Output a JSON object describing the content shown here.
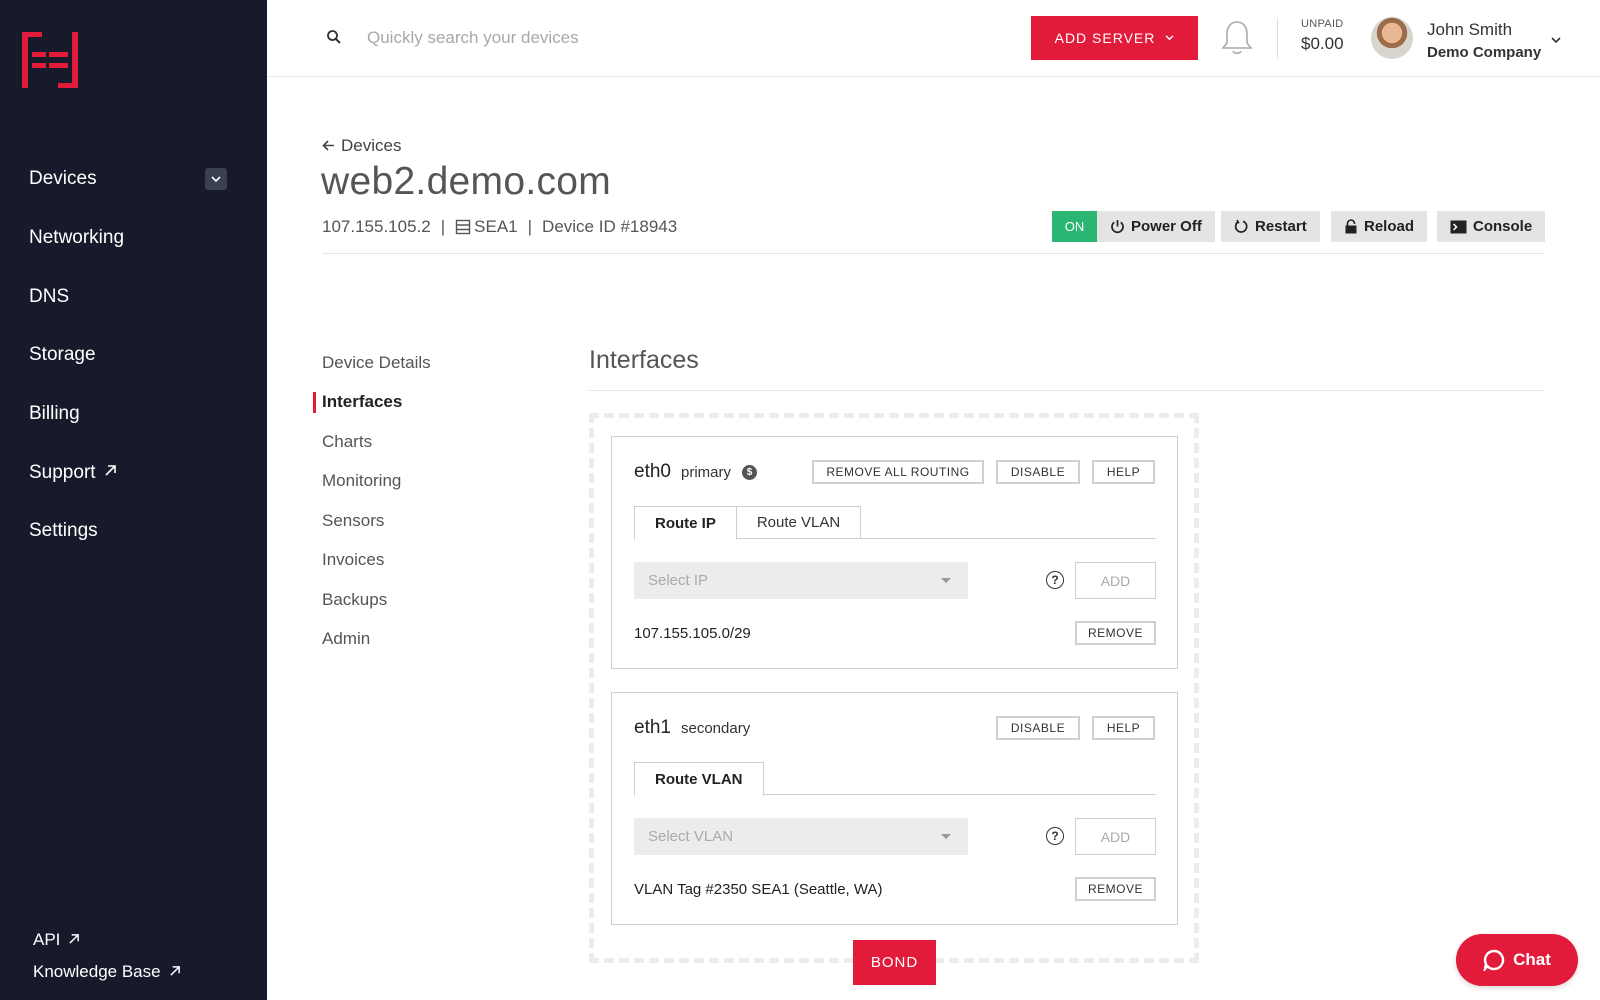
{
  "sidebar": {
    "logo": "hivelocity-logo",
    "items": [
      {
        "label": "Devices",
        "icon": "chevron-down-icon"
      },
      {
        "label": "Networking"
      },
      {
        "label": "DNS"
      },
      {
        "label": "Storage"
      },
      {
        "label": "Billing"
      },
      {
        "label": "Support",
        "icon": "external-link-icon"
      },
      {
        "label": "Settings"
      }
    ],
    "bottom_links": [
      {
        "label": "API",
        "icon": "external-link-icon"
      },
      {
        "label": "Knowledge Base",
        "icon": "external-link-icon"
      }
    ]
  },
  "header": {
    "search_placeholder": "Quickly search your devices",
    "add_server_label": "ADD SERVER",
    "unpaid_label": "UNPAID",
    "unpaid_amount": "$0.00",
    "user_name": "John Smith",
    "user_company": "Demo Company"
  },
  "device": {
    "breadcrumb": "Devices",
    "title": "web2.demo.com",
    "ip": "107.155.105.2",
    "location": "SEA1",
    "device_id": "Device ID #18943",
    "status": "ON",
    "actions": [
      "Power Off",
      "Restart",
      "Reload",
      "Console"
    ]
  },
  "subnav": {
    "items": [
      "Device Details",
      "Interfaces",
      "Charts",
      "Monitoring",
      "Sensors",
      "Invoices",
      "Backups",
      "Admin"
    ],
    "active": "Interfaces"
  },
  "interfaces": {
    "title": "Interfaces",
    "eth0": {
      "name": "eth0",
      "role": "primary",
      "badge": "$",
      "buttons": [
        "REMOVE ALL ROUTING",
        "DISABLE",
        "HELP"
      ],
      "tabs": [
        "Route IP",
        "Route VLAN"
      ],
      "active_tab": "Route IP",
      "select_placeholder": "Select IP",
      "add_label": "ADD",
      "routes": [
        "107.155.105.0/29"
      ],
      "remove_label": "REMOVE"
    },
    "eth1": {
      "name": "eth1",
      "role": "secondary",
      "buttons": [
        "DISABLE",
        "HELP"
      ],
      "tabs": [
        "Route VLAN"
      ],
      "active_tab": "Route VLAN",
      "select_placeholder": "Select VLAN",
      "add_label": "ADD",
      "routes": [
        "VLAN Tag #2350 SEA1 (Seattle, WA)"
      ],
      "remove_label": "REMOVE"
    },
    "bond_label": "BOND"
  },
  "chat": {
    "label": "Chat"
  },
  "colors": {
    "accent": "#e31b3b",
    "sidebar_bg": "#171a2b",
    "status_on": "#2bb673"
  }
}
